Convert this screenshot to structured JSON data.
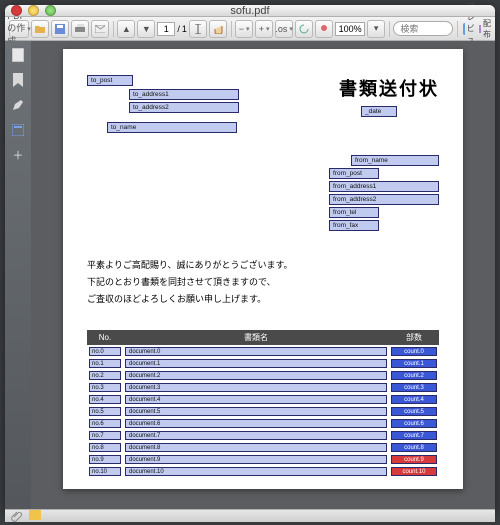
{
  "window": {
    "title": "sofu.pdf"
  },
  "toolbar": {
    "create_label": "PDF の作成",
    "page_current": "1",
    "page_sep": "/",
    "page_total": "1",
    "zoom": "100%",
    "search_placeholder": "検索",
    "preview_label": "プレビュー",
    "distribute_label": "配布",
    "os_label": ".os"
  },
  "doc": {
    "to_post": "to_post",
    "to_address1": "to_address1",
    "to_address2": "to_address2",
    "to_name": "to_name",
    "heading": "書類送付状",
    "date": "_date",
    "from_name": "from_name",
    "from_post": "from_post",
    "from_address1": "from_address1",
    "from_address2": "from_address2",
    "from_tel": "from_tel",
    "from_fax": "from_fax",
    "body_line1": "平素よりご高配賜り、誠にありがとうございます。",
    "body_line2": "下記のとおり書類を同封させて頂きますので、",
    "body_line3": "ご査収のほどよろしくお願い申し上げます。",
    "th_no": "No.",
    "th_doc": "書類名",
    "th_cnt": "部数",
    "rows": [
      {
        "no": "no.0",
        "doc": "document.0",
        "cnt": "count.0",
        "cls": "blue"
      },
      {
        "no": "no.1",
        "doc": "document.1",
        "cnt": "count.1",
        "cls": "blue"
      },
      {
        "no": "no.2",
        "doc": "document.2",
        "cnt": "count.2",
        "cls": "blue"
      },
      {
        "no": "no.3",
        "doc": "document.3",
        "cnt": "count.3",
        "cls": "blue"
      },
      {
        "no": "no.4",
        "doc": "document.4",
        "cnt": "count.4",
        "cls": "blue"
      },
      {
        "no": "no.5",
        "doc": "document.5",
        "cnt": "count.5",
        "cls": "blue"
      },
      {
        "no": "no.6",
        "doc": "document.6",
        "cnt": "count.6",
        "cls": "blue"
      },
      {
        "no": "no.7",
        "doc": "document.7",
        "cnt": "count.7",
        "cls": "blue"
      },
      {
        "no": "no.8",
        "doc": "document.8",
        "cnt": "count.8",
        "cls": "blue"
      },
      {
        "no": "no.9",
        "doc": "document.9",
        "cnt": "count.9",
        "cls": "red"
      },
      {
        "no": "no.10",
        "doc": "document.10",
        "cnt": "count.10",
        "cls": "red"
      }
    ]
  }
}
